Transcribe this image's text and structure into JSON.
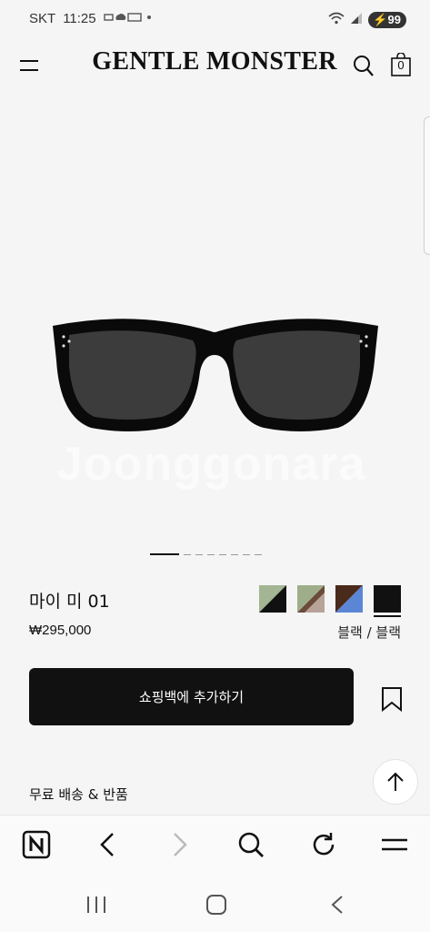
{
  "status_bar": {
    "carrier": "SKT",
    "time": "11:25",
    "battery": "99"
  },
  "header": {
    "brand": "GENTLE MONSTER",
    "cart_count": "0"
  },
  "product": {
    "watermark": "Joonggonara",
    "name": "마이 미 01",
    "price": "₩295,000",
    "color_label": "블랙 / 블랙",
    "add_to_bag_label": "쇼핑백에 추가하기",
    "shipping_label": "무료 배송 & 반품",
    "carousel": {
      "total_images": 8,
      "active_index": 0
    },
    "swatches": [
      {
        "name": "green-black-swatch",
        "top_color": "#a3b592",
        "bottom_color": "#111111",
        "selected": false
      },
      {
        "name": "green-brown-swatch",
        "top_color": "#9fae8a",
        "bottom_color": "#6b4a3a",
        "selected": false
      },
      {
        "name": "brown-blue-swatch",
        "top_color": "#4a2a1a",
        "bottom_color": "#5b86d6",
        "selected": false
      },
      {
        "name": "black-swatch",
        "top_color": "#111111",
        "bottom_color": "#111111",
        "selected": true
      }
    ]
  },
  "browser_bar": {
    "icons": [
      "naver-icon",
      "back-icon",
      "forward-icon",
      "search-icon",
      "reload-icon",
      "menu-icon"
    ]
  },
  "system_nav": {
    "icons": [
      "recents-icon",
      "home-icon",
      "back-icon"
    ]
  }
}
